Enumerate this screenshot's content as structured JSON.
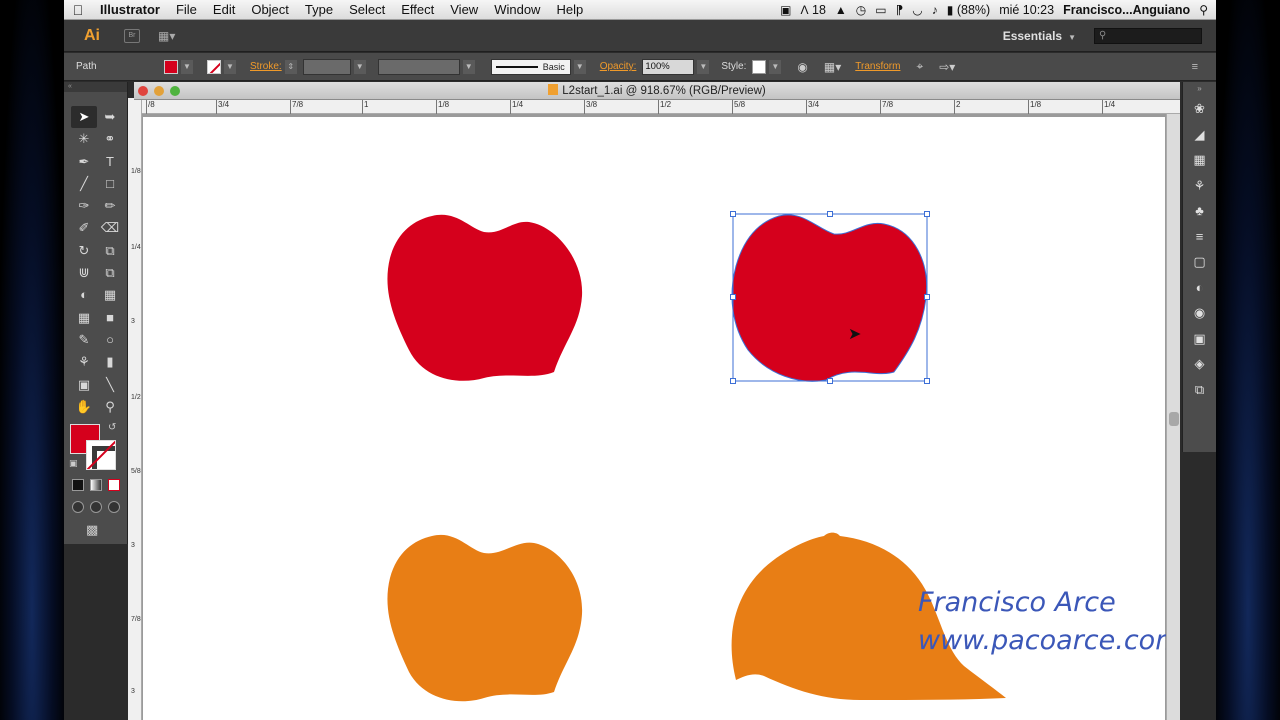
{
  "menubar": {
    "items": [
      "Illustrator",
      "File",
      "Edit",
      "Object",
      "Type",
      "Select",
      "Effect",
      "View",
      "Window",
      "Help"
    ],
    "adobe_count": "18",
    "battery": "(88%)",
    "clock": "mié 10:23",
    "user": "Francisco...Anguiano"
  },
  "appbar": {
    "logo": "Ai",
    "bridge_label": "Br",
    "workspace": "Essentials",
    "search_placeholder": ""
  },
  "control": {
    "selection_type": "Path",
    "stroke_label": "Stroke:",
    "brush_label": "Basic",
    "opacity_label": "Opacity:",
    "opacity_value": "100%",
    "style_label": "Style:",
    "transform_label": "Transform"
  },
  "document": {
    "title": "L2start_1.ai @ 918.67% (RGB/Preview)"
  },
  "ruler": {
    "h": [
      "/8",
      "3/4",
      "7/8",
      "1",
      "1/8",
      "1/4",
      "3/8",
      "1/2",
      "5/8",
      "3/4",
      "7/8",
      "2",
      "1/8",
      "1/4"
    ],
    "v": [
      "1/8",
      "1/4",
      "3",
      "1/2",
      "5/8",
      "3",
      "7/8",
      "3"
    ]
  },
  "watermark": {
    "name": "Francisco Arce",
    "url": "www.pacoarce.com"
  },
  "colors": {
    "fill_red": "#d5001c",
    "fill_orange": "#e87e15",
    "selection_blue": "#3d6fd6"
  }
}
